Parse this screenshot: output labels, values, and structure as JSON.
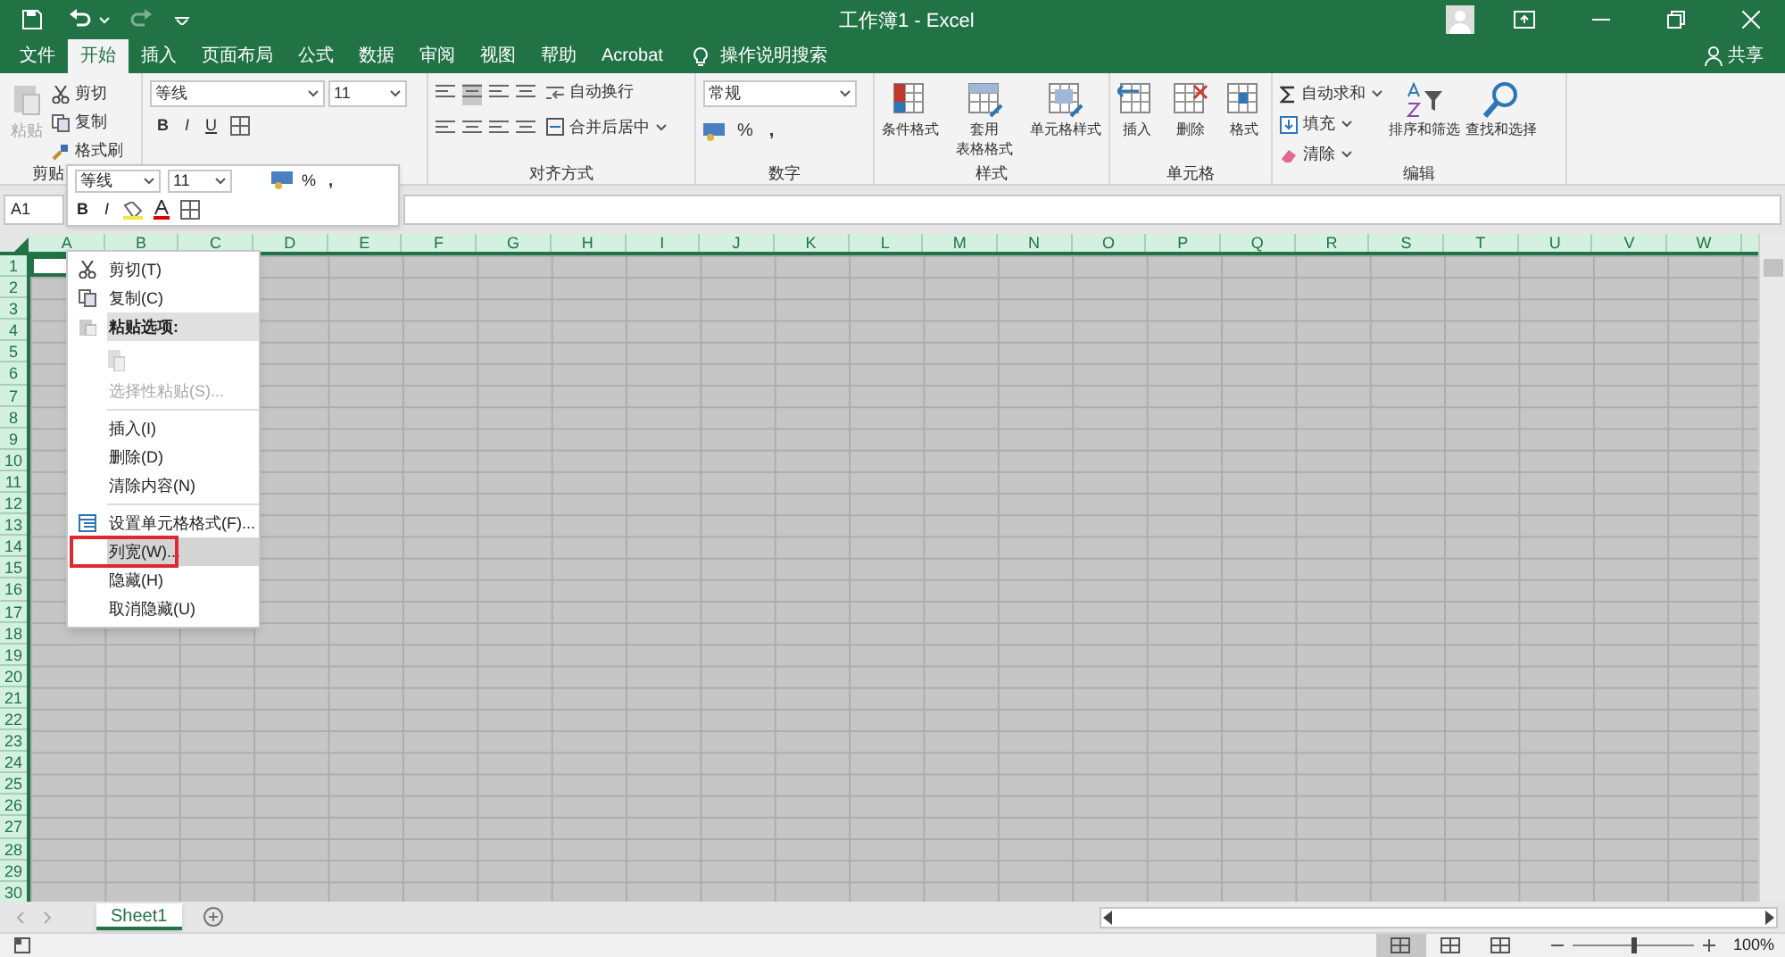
{
  "title_bar": {
    "title": "工作簿1 - Excel"
  },
  "tabs": [
    {
      "label": "文件",
      "selected": false
    },
    {
      "label": "开始",
      "selected": true
    },
    {
      "label": "插入",
      "selected": false
    },
    {
      "label": "页面布局",
      "selected": false
    },
    {
      "label": "公式",
      "selected": false
    },
    {
      "label": "数据",
      "selected": false
    },
    {
      "label": "审阅",
      "selected": false
    },
    {
      "label": "视图",
      "selected": false
    },
    {
      "label": "帮助",
      "selected": false
    },
    {
      "label": "Acrobat",
      "selected": false
    }
  ],
  "tell_me": "操作说明搜索",
  "share": "共享",
  "ribbon": {
    "clipboard": {
      "paste": "粘贴",
      "cut": "剪切",
      "copy": "复制",
      "format_painter": "格式刷",
      "label": "剪贴"
    },
    "font": {
      "font_name": "等线",
      "font_size": "11",
      "bold": "B",
      "italic": "I",
      "underline": "U"
    },
    "alignment": {
      "wrap": "自动换行",
      "merge": "合并后居中",
      "label": "对齐方式"
    },
    "number": {
      "format": "常规",
      "percent": "%",
      "comma": ",",
      "label": "数字"
    },
    "styles": {
      "buttons": [
        {
          "lines": [
            "条件格式"
          ]
        },
        {
          "lines": [
            "套用",
            "表格格式"
          ]
        },
        {
          "lines": [
            "单元格样式"
          ]
        }
      ],
      "label": "样式"
    },
    "cells": {
      "buttons": [
        {
          "lines": [
            "插入"
          ]
        },
        {
          "lines": [
            "删除"
          ]
        },
        {
          "lines": [
            "格式"
          ]
        }
      ],
      "label": "单元格"
    },
    "editing": {
      "autosum": "自动求和",
      "fill": "填充",
      "clear": "清除",
      "sort": "排序和筛选",
      "find": "查找和选择",
      "label": "编辑"
    }
  },
  "mini_toolbar": {
    "font_name": "等线",
    "font_size": "11",
    "percent": "%",
    "comma": ",",
    "bold": "B",
    "italic": "I"
  },
  "name_box": "A1",
  "columns": [
    "A",
    "B",
    "C",
    "D",
    "E",
    "F",
    "G",
    "H",
    "I",
    "J",
    "K",
    "L",
    "M",
    "N",
    "O",
    "P",
    "Q",
    "R",
    "S",
    "T",
    "U",
    "V",
    "W"
  ],
  "rows": [
    "1",
    "2",
    "3",
    "4",
    "5",
    "6",
    "7",
    "8",
    "9",
    "10",
    "11",
    "12",
    "13",
    "14",
    "15",
    "16",
    "17",
    "18",
    "19",
    "20",
    "21",
    "22",
    "23",
    "24",
    "25",
    "26",
    "27",
    "28",
    "29",
    "30"
  ],
  "context_menu": [
    {
      "kind": "cut",
      "label": "剪切(T)",
      "disabled": false,
      "selected": false,
      "outlined": false
    },
    {
      "kind": "copy",
      "label": "复制(C)",
      "disabled": false,
      "selected": false,
      "outlined": false
    },
    {
      "kind": "paste_header",
      "label": "粘贴选项:"
    },
    {
      "kind": "paste_option"
    },
    {
      "kind": "item",
      "label": "选择性粘贴(S)...",
      "disabled": true,
      "selected": false,
      "outlined": false
    },
    {
      "kind": "separator"
    },
    {
      "kind": "item",
      "label": "插入(I)",
      "disabled": false,
      "selected": false,
      "outlined": false
    },
    {
      "kind": "item",
      "label": "删除(D)",
      "disabled": false,
      "selected": false,
      "outlined": false
    },
    {
      "kind": "item",
      "label": "清除内容(N)",
      "disabled": false,
      "selected": false,
      "outlined": false
    },
    {
      "kind": "separator"
    },
    {
      "kind": "format_cells",
      "label": "设置单元格格式(F)...",
      "disabled": false,
      "selected": false,
      "outlined": false
    },
    {
      "kind": "item",
      "label": "列宽(W)...",
      "disabled": false,
      "selected": true,
      "outlined": true
    },
    {
      "kind": "item",
      "label": "隐藏(H)",
      "disabled": false,
      "selected": false,
      "outlined": false
    },
    {
      "kind": "item",
      "label": "取消隐藏(U)",
      "disabled": false,
      "selected": false,
      "outlined": false
    }
  ],
  "sheet_tabs": [
    {
      "label": "Sheet1",
      "selected": true
    }
  ],
  "views": [
    {
      "selected": true
    },
    {
      "selected": false
    },
    {
      "selected": false
    }
  ],
  "zoom_slider": {
    "level": 0.5
  },
  "zoom": "100%"
}
